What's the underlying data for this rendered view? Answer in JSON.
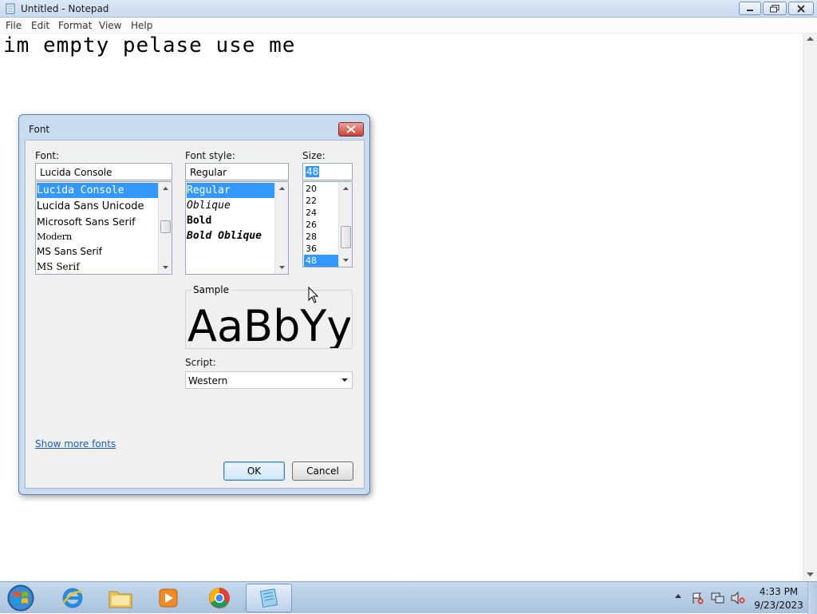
{
  "window": {
    "title": "Untitled - Notepad"
  },
  "menu": {
    "items": [
      "File",
      "Edit",
      "Format",
      "View",
      "Help"
    ]
  },
  "editor": {
    "content": "im empty pelase use me"
  },
  "font_dialog": {
    "title": "Font",
    "font_label": "Font:",
    "font_value": "Lucida Console",
    "font_list": [
      "Lucida Console",
      "Lucida Sans Unicode",
      "Microsoft Sans Serif",
      "Modern",
      "MS Sans Serif",
      "MS Serif"
    ],
    "font_selected_index": 0,
    "style_label": "Font style:",
    "style_value": "Regular",
    "style_list": [
      "Regular",
      "Oblique",
      "Bold",
      "Bold Oblique"
    ],
    "style_selected_index": 0,
    "size_label": "Size:",
    "size_value": "48",
    "size_list": [
      "20",
      "22",
      "24",
      "26",
      "28",
      "36",
      "48"
    ],
    "size_selected_index": 6,
    "sample_label": "Sample",
    "sample_text": "AaBbYyZz",
    "script_label": "Script:",
    "script_value": "Western",
    "show_more_fonts": "Show more fonts",
    "ok_label": "OK",
    "cancel_label": "Cancel"
  },
  "taskbar": {
    "apps": [
      "internet-explorer",
      "windows-explorer",
      "media-player",
      "chrome",
      "notepad"
    ],
    "active_app": "notepad",
    "time": "4:33 PM",
    "date": "9/23/2023"
  },
  "colors": {
    "selection": "#3399ff",
    "link": "#1a5fb4",
    "close_button": "#c5443a"
  }
}
